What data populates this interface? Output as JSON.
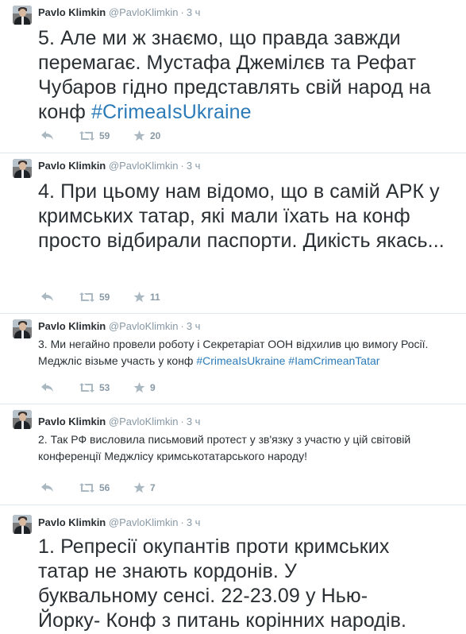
{
  "author": {
    "name": "Pavlo Klimkin",
    "handle": "@PavloKlimkin",
    "time": "3 ч"
  },
  "tweets": [
    {
      "text": "5. Але ми ж знаємо, що правда завжди перемагає. Мустафа Джемілєв та Рефат Чубаров гідно представлять свій народ на конф ",
      "hashtags": [
        "#CrimeaIsUkraine"
      ],
      "retweets": "59",
      "favorites": "20"
    },
    {
      "text": "4. При цьому нам відомо, що в самій АРК у кримських татар, які мали їхать на конф просто відбирали паспорти. Дикість якась...",
      "hashtags": [],
      "retweets": "59",
      "favorites": "11"
    },
    {
      "text": "3. Ми негайно провели роботу і Секретаріат ООН відхилив цю вимогу Росії. Меджліс візьме участь у конф ",
      "hashtags": [
        "#CrimeaIsUkraine",
        "#IamCrimeanTatar"
      ],
      "retweets": "53",
      "favorites": "9"
    },
    {
      "text": "2. Так РФ висловила письмовий протест у зв'язку з участю у цій світовій конференції Меджлісу кримськотатарського народу!",
      "hashtags": [],
      "retweets": "56",
      "favorites": "7"
    },
    {
      "text": "1. Репресії окупантів проти кримських татар не знають кордонів. У буквальному сенсі. 22-23.09 у Нью-Йорку- Конф з питань корінних народів.",
      "hashtags": []
    }
  ],
  "icons": {
    "reply": "reply-icon",
    "retweet": "retweet-icon",
    "favorite": "star-icon"
  },
  "colors": {
    "link": "#2b7bb9",
    "muted": "#8899a6",
    "text": "#292f33",
    "divider": "#e1e8ed"
  }
}
